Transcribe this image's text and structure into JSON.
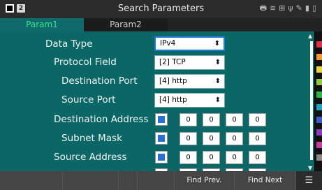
{
  "titlebar": {
    "title": "Search Parameters",
    "left_icons": [
      "stop-square-icon",
      "page-number-icon"
    ],
    "page_badge": "2",
    "status_icons": [
      "printer-icon",
      "wifi-icon",
      "network-icon",
      "usb-icon",
      "tool-icon",
      "sd-card-icon",
      "battery-icon"
    ]
  },
  "tabs": [
    {
      "label": "Param1",
      "active": true
    },
    {
      "label": "Param2",
      "active": false
    }
  ],
  "fields": {
    "data_type": {
      "label": "Data Type",
      "value": "IPv4"
    },
    "protocol_field": {
      "label": "Protocol Field",
      "value": "[2] TCP"
    },
    "destination_port": {
      "label": "Destination Port",
      "value": "[4] http"
    },
    "source_port": {
      "label": "Source Port",
      "value": "[4] http"
    },
    "destination_address": {
      "label": "Destination Address",
      "octets": [
        "0",
        "0",
        "0",
        "0"
      ]
    },
    "dest_subnet_mask": {
      "label": "Subnet Mask",
      "octets": [
        "0",
        "0",
        "0",
        "0"
      ]
    },
    "source_address": {
      "label": "Source Address",
      "octets": [
        "0",
        "0",
        "0",
        "0"
      ]
    }
  },
  "function_keys": [
    "",
    "",
    "",
    "",
    "Find Prev.",
    "Find Next"
  ],
  "menu_icon": "menu-lines-icon",
  "strip_colors": [
    "#e0304a",
    "#f29a2e",
    "#e8d83a",
    "#8ccc3c",
    "#2fb44a",
    "#21a0c8",
    "#3b5cc8",
    "#8a3cc0",
    "#c83c9a",
    "#888888"
  ],
  "colors": {
    "panel": "#0b6666",
    "tab_active_text": "#3fe08c",
    "focus_border": "#1e78d6"
  }
}
